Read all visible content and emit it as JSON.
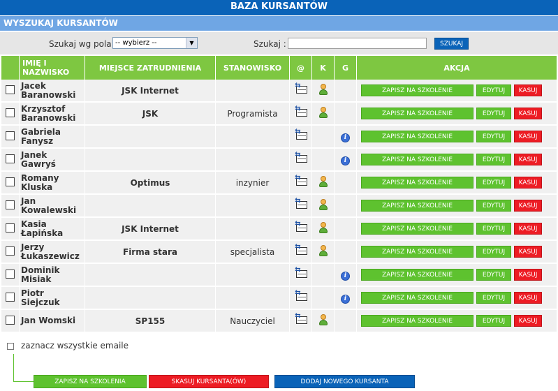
{
  "header": {
    "title": "BAZA KURSANTÓW"
  },
  "search": {
    "section_title": "WYSZUKAJ KURSANTÓW",
    "by_field_label": "Szukaj wg pola:",
    "select_value": "-- wybierz --",
    "search_label": "Szukaj :",
    "search_value": "",
    "button_label": "SZUKAJ"
  },
  "table": {
    "columns": {
      "name": "IMIĘ I NAZWISKO",
      "employer": "MIEJSCE ZATRUDNIENIA",
      "position": "STANOWISKO",
      "email": "@",
      "k": "K",
      "g": "G",
      "action": "AKCJA"
    },
    "action_labels": {
      "enroll": "ZAPISZ NA SZKOLENIE",
      "edit": "EDYTUJ",
      "delete": "KASUJ"
    },
    "rows": [
      {
        "first": "Jacek",
        "last": "Baranowski",
        "employer": "JSK Internet",
        "position": "",
        "k": true,
        "g": false
      },
      {
        "first": "Krzysztof",
        "last": "Baranowski",
        "employer": "JSK",
        "position": "Programista",
        "k": true,
        "g": false
      },
      {
        "first": "Gabriela",
        "last": "Fanysz",
        "employer": "",
        "position": "",
        "k": false,
        "g": true
      },
      {
        "first": "Janek Gawryś",
        "last": "",
        "employer": "",
        "position": "",
        "k": false,
        "g": true
      },
      {
        "first": "Romany",
        "last": "Kluska",
        "employer": "Optimus",
        "position": "inzynier",
        "k": true,
        "g": false
      },
      {
        "first": "Jan",
        "last": "Kowalewski",
        "employer": "",
        "position": "",
        "k": true,
        "g": false
      },
      {
        "first": "Kasia Łapińska",
        "last": "",
        "employer": "JSK Internet",
        "position": "",
        "k": true,
        "g": false
      },
      {
        "first": "Jerzy",
        "last": "Łukaszewicz",
        "employer": "Firma stara",
        "position": "specjalista",
        "k": true,
        "g": false
      },
      {
        "first": "Dominik",
        "last": "Misiak",
        "employer": "",
        "position": "",
        "k": false,
        "g": true
      },
      {
        "first": "Piotr Siejczuk",
        "last": "",
        "employer": "",
        "position": "",
        "k": false,
        "g": true
      },
      {
        "first": "Jan Womski",
        "last": "",
        "employer": "SP155",
        "position": "Nauczyciel",
        "k": true,
        "g": false
      }
    ]
  },
  "footer": {
    "select_all_label": "zaznacz wszystkie emaile",
    "enroll_button": "ZAPISZ NA SZKOLENIA",
    "delete_button": "SKASUJ KURSANTA(ÓW)",
    "add_button": "DODAJ NOWEGO KURSANTA"
  }
}
